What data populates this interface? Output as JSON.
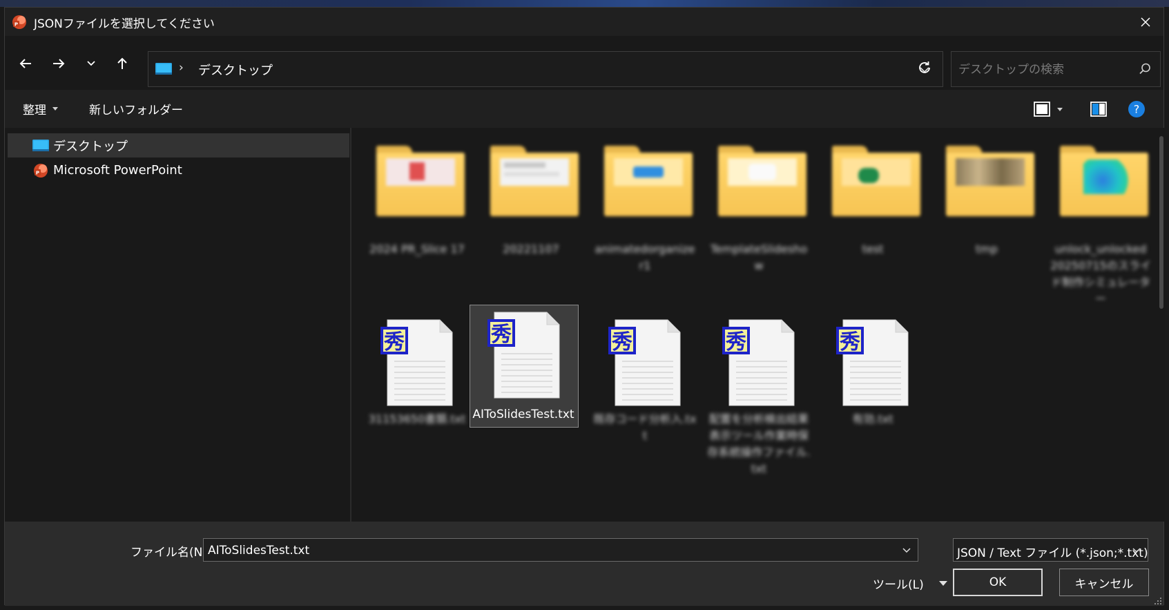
{
  "window": {
    "title": "JSONファイルを選択してください"
  },
  "navigation": {
    "back_label": "←",
    "forward_label": "→",
    "up_label": "↑"
  },
  "address": {
    "location": "デスクトップ",
    "separator": "›"
  },
  "search": {
    "placeholder": "デスクトップの検索",
    "value": ""
  },
  "toolbar": {
    "organize_label": "整理",
    "new_folder_label": "新しいフォルダー",
    "help_label": "?"
  },
  "sidebar": {
    "items": [
      {
        "label": "デスクトップ",
        "icon": "desktop-icon",
        "selected": true
      },
      {
        "label": "Microsoft PowerPoint",
        "icon": "powerpoint-icon",
        "selected": false
      }
    ]
  },
  "files": {
    "folders": [
      {
        "label": "2024 PR_Slice 17",
        "thumb": "red"
      },
      {
        "label": "20221107",
        "thumb": "doc"
      },
      {
        "label": "animatedorganizer1",
        "thumb": "blue"
      },
      {
        "label": "TemplateSlideshow",
        "thumb": "white"
      },
      {
        "label": "test",
        "thumb": "green"
      },
      {
        "label": "tmp",
        "thumb": "photo"
      },
      {
        "label": "unlock_unlocked 20250715のスライド制作シミュレーター",
        "thumb": "swirl"
      }
    ],
    "text_files": [
      {
        "label": "31153650書類.txt",
        "selected": false,
        "blurred": true
      },
      {
        "label": "AIToSlidesTest.txt",
        "selected": true,
        "blurred": false
      },
      {
        "label": "既存コード分析入.txt",
        "selected": false,
        "blurred": true
      },
      {
        "label": "配置を分析検出結果表示ツール作業時保存系統操作ファイル.txt",
        "selected": false,
        "blurred": true
      },
      {
        "label": "有効.txt",
        "selected": false,
        "blurred": true
      }
    ]
  },
  "bottom": {
    "filename_label": "ファイル名(N):",
    "filename_value": "AIToSlidesTest.txt",
    "file_type": "JSON / Text ファイル (*.json;*.txt)",
    "tools_label": "ツール(L)",
    "ok_label": "OK",
    "cancel_label": "キャンセル"
  },
  "colors": {
    "window_bg": "#202020",
    "panel_bg": "#191919",
    "bottom_bg": "#2c2c2c",
    "selected_bg": "#333333",
    "folder_yellow": "#f6c453",
    "help_blue": "#1a7fe0"
  }
}
